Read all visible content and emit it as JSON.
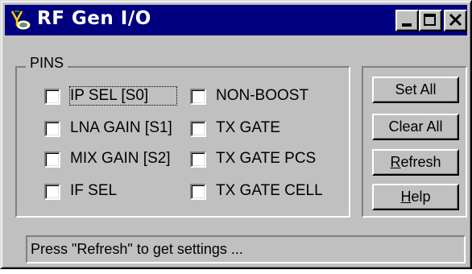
{
  "window": {
    "title": "RF Gen I/O",
    "controls": {
      "minimize": "minimize",
      "maximize": "maximize",
      "close": "close"
    }
  },
  "pins": {
    "legend": "PINS",
    "left_column": [
      {
        "label": "IP SEL [S0]",
        "checked": false,
        "focused": true
      },
      {
        "label": "LNA GAIN [S1]",
        "checked": false
      },
      {
        "label": "MIX GAIN [S2]",
        "checked": false
      },
      {
        "label": "IF SEL",
        "checked": false
      }
    ],
    "right_column": [
      {
        "label": "NON-BOOST",
        "checked": false
      },
      {
        "label": "TX GATE",
        "checked": false
      },
      {
        "label": "TX GATE PCS",
        "checked": false
      },
      {
        "label": "TX GATE CELL",
        "checked": false
      }
    ]
  },
  "buttons": {
    "set_all": "Set All",
    "clear_all": "Clear All",
    "refresh": "Refresh",
    "help": "Help"
  },
  "status": "Press \"Refresh\" to get settings ...",
  "icons": {
    "app": "rf-generator-icon"
  },
  "colors": {
    "titlebar": "#000080",
    "face": "#c0c0c0"
  }
}
